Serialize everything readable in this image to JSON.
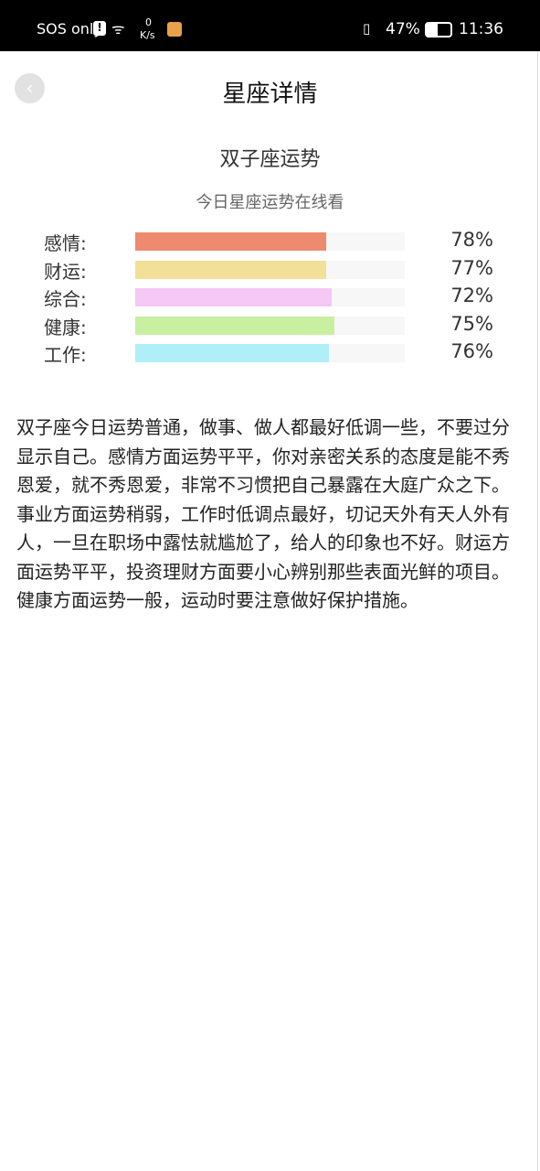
{
  "status_bar": {
    "carrier": "SOS only",
    "net_speed_value": "0",
    "net_speed_unit": "K/s",
    "battery": "47%",
    "time": "11:36"
  },
  "header": {
    "back_icon": "chevron-left-icon",
    "title": "星座详情"
  },
  "sign_title": "双子座运势",
  "subtitle": "今日星座运势在线看",
  "bars": [
    {
      "label": "感情:",
      "percent": "78%",
      "fill": 0.71,
      "color": "#ee8a6e"
    },
    {
      "label": "财运:",
      "percent": "77%",
      "fill": 0.71,
      "color": "#f2e098"
    },
    {
      "label": "综合:",
      "percent": "72%",
      "fill": 0.73,
      "color": "#f5c8f5"
    },
    {
      "label": "健康:",
      "percent": "75%",
      "fill": 0.74,
      "color": "#c8f0a0"
    },
    {
      "label": "工作:",
      "percent": "76%",
      "fill": 0.72,
      "color": "#b0eef8"
    }
  ],
  "description": "双子座今日运势普通，做事、做人都最好低调一些，不要过分显示自己。感情方面运势平平，你对亲密关系的态度是能不秀恩爱，就不秀恩爱，非常不习惯把自己暴露在大庭广众之下。事业方面运势稍弱，工作时低调点最好，切记天外有天人外有人，一旦在职场中露怯就尴尬了，给人的印象也不好。财运方面运势平平，投资理财方面要小心辨别那些表面光鲜的项目。健康方面运势一般，运动时要注意做好保护措施。"
}
